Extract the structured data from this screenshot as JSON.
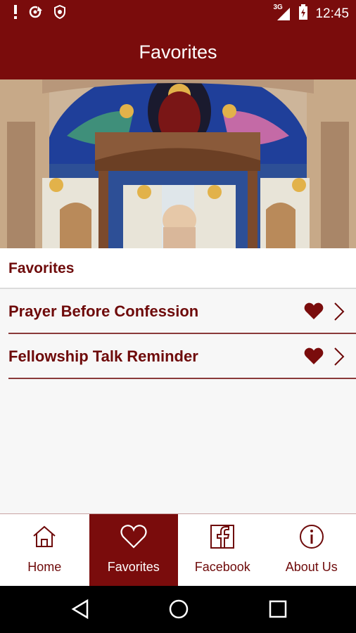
{
  "status_bar": {
    "time": "12:45",
    "network": "3G",
    "icons": [
      "alert-icon",
      "sync-icon",
      "shield-icon",
      "signal-icon",
      "battery-icon"
    ]
  },
  "app_bar": {
    "title": "Favorites"
  },
  "hero": {
    "image": "church-altar-image"
  },
  "section": {
    "title": "Favorites"
  },
  "favorites": [
    {
      "label": "Prayer Before Confession"
    },
    {
      "label": "Fellowship Talk Reminder"
    }
  ],
  "bottom_nav": {
    "items": [
      {
        "label": "Home",
        "icon": "home-icon"
      },
      {
        "label": "Favorites",
        "icon": "heart-outline-icon"
      },
      {
        "label": "Facebook",
        "icon": "facebook-icon"
      },
      {
        "label": "About Us",
        "icon": "info-icon"
      }
    ],
    "active": "Favorites"
  },
  "colors": {
    "primary": "#7a0c0c",
    "text": "#6e0a0a",
    "background": "#f7f7f7"
  }
}
